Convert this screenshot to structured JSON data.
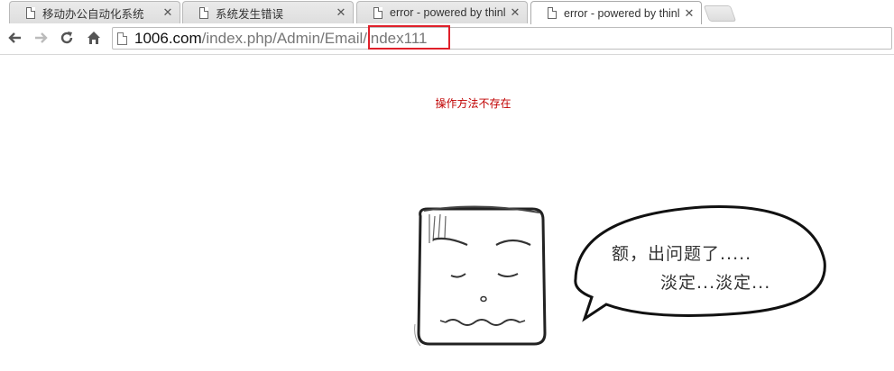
{
  "tabs": [
    {
      "title": "移动办公自动化系统",
      "active": false
    },
    {
      "title": "系统发生错误",
      "active": false
    },
    {
      "title": "error - powered by thinl",
      "active": false
    },
    {
      "title": "error - powered by thinl",
      "active": true
    }
  ],
  "toolbar": {
    "back_icon": "←",
    "forward_icon": "→",
    "reload_icon": "↻",
    "home_icon": "⌂"
  },
  "address": {
    "host": "1006.com",
    "path": "/index.php/Admin/Email/index111"
  },
  "error": {
    "message": "操作方法不存在"
  },
  "illustration": {
    "line1": "额，出问题了.....",
    "line2": "淡定...淡定..."
  },
  "colors": {
    "error_text": "#c00000",
    "annotation_box": "#e0202a"
  }
}
